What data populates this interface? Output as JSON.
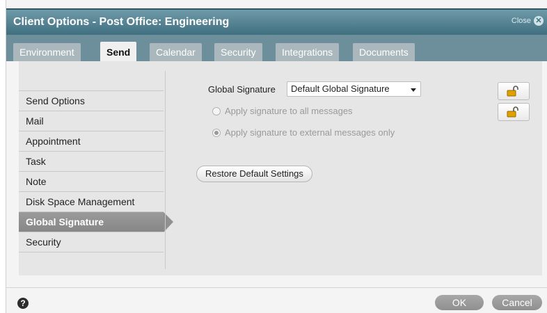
{
  "title": "Client Options - Post Office: Engineering",
  "close_label": "Close",
  "tabs": [
    {
      "label": "Environment"
    },
    {
      "label": "Send"
    },
    {
      "label": "Calendar"
    },
    {
      "label": "Security"
    },
    {
      "label": "Integrations"
    },
    {
      "label": "Documents"
    }
  ],
  "active_tab": "Send",
  "nav": [
    {
      "label": "Send Options"
    },
    {
      "label": "Mail"
    },
    {
      "label": "Appointment"
    },
    {
      "label": "Task"
    },
    {
      "label": "Note"
    },
    {
      "label": "Disk Space Management"
    },
    {
      "label": "Global Signature"
    },
    {
      "label": "Security"
    }
  ],
  "active_nav": "Global Signature",
  "signature": {
    "label": "Global Signature",
    "selected": "Default Global Signature",
    "option_all": "Apply signature to all messages",
    "option_external": "Apply signature to external messages only",
    "checked": "external"
  },
  "restore_label": "Restore Default Settings",
  "footer": {
    "ok": "OK",
    "cancel": "Cancel",
    "help": "?"
  },
  "colors": {
    "titlebar": "#4f7f90",
    "tabstrip": "#6d8f9b",
    "active_nav": "#909090",
    "lock": "#e0a000"
  }
}
